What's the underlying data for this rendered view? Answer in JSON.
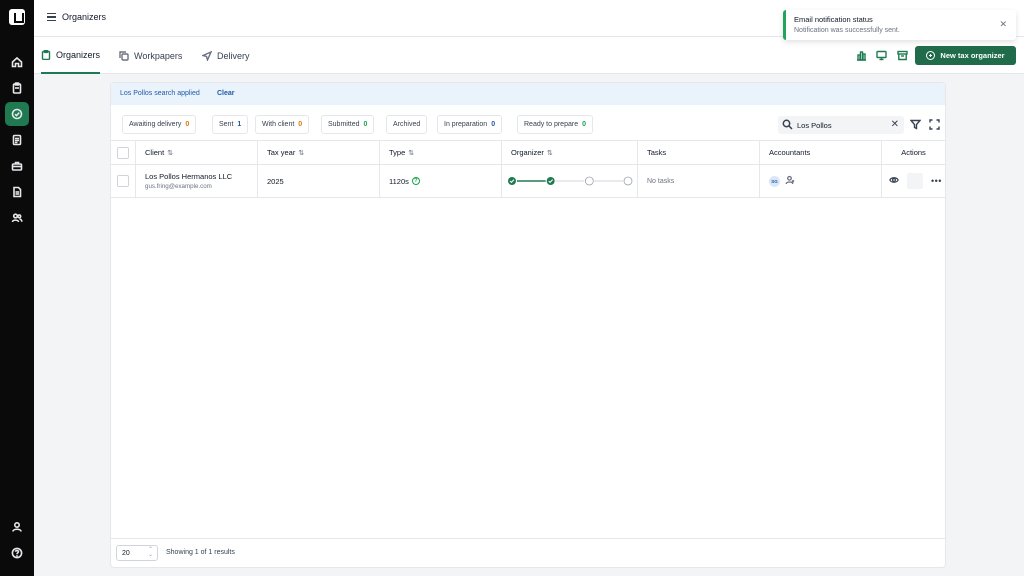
{
  "nav": {
    "items": [
      "home-icon",
      "clipboard-icon",
      "organizer-icon",
      "document-icon",
      "briefcase-icon",
      "file-icon",
      "users-icon"
    ],
    "bottom": [
      "account-icon",
      "help-icon"
    ]
  },
  "topbar": {
    "title": "Organizers"
  },
  "tabs": [
    {
      "label": "Organizers",
      "icon": "clipboard-icon",
      "active": true
    },
    {
      "label": "Workpapers",
      "icon": "copy-icon",
      "active": false
    },
    {
      "label": "Delivery",
      "icon": "send-icon",
      "active": false
    }
  ],
  "toolbar": {
    "new_button": "New tax organizer"
  },
  "toast": {
    "title": "Email notification status",
    "message": "Notification was successfully sent.",
    "accent": "#22a55b"
  },
  "search_banner": {
    "text": "Los Pollos search applied",
    "clear": "Clear"
  },
  "filters": [
    {
      "label": "Awaiting delivery",
      "count": "0",
      "color": "orange"
    },
    {
      "label": "Sent",
      "count": "1",
      "color": "blue"
    },
    {
      "label": "With client",
      "count": "0",
      "color": "orange"
    },
    {
      "label": "Submitted",
      "count": "0",
      "color": "green"
    },
    {
      "label": "Archived",
      "count": "",
      "color": ""
    },
    {
      "label": "In preparation",
      "count": "0",
      "color": "blue"
    },
    {
      "label": "Ready to prepare",
      "count": "0",
      "color": "green"
    }
  ],
  "search": {
    "value": "Los Pollos"
  },
  "table": {
    "headers": {
      "client": "Client",
      "tax_year": "Tax year",
      "type": "Type",
      "organizer": "Organizer",
      "tasks": "Tasks",
      "accountants": "Accountants",
      "actions": "Actions"
    },
    "rows": [
      {
        "client_name": "Los Pollos Hermanos LLC",
        "client_email": "gus.fring@example.com",
        "tax_year": "2025",
        "type": "1120s",
        "organizer_steps_done": 2,
        "organizer_steps_total": 4,
        "tasks": "No tasks",
        "accountant_initials": "SG"
      }
    ]
  },
  "footer": {
    "page_size": "20",
    "showing": "Showing 1 of 1 results"
  },
  "colors": {
    "brand": "#1f7a52",
    "button": "#1f6b4a"
  }
}
